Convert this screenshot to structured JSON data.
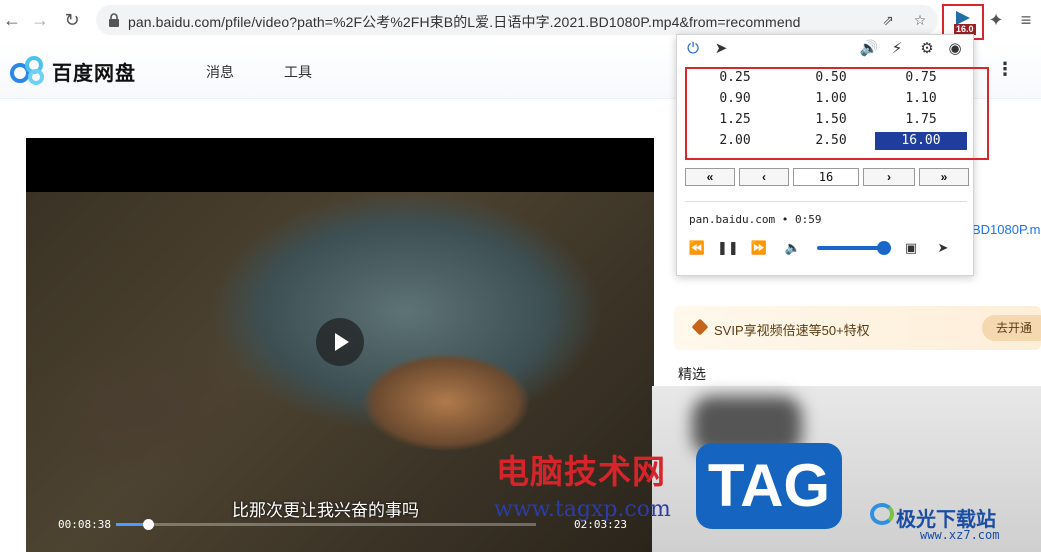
{
  "browser": {
    "url": "pan.baidu.com/pfile/video?path=%2F公考%2FH束B的L爱.日语中字.2021.BD1080P.mp4&from=recommend",
    "extension_badge": "16.0"
  },
  "site": {
    "brand": "百度网盘",
    "menu": [
      "消息",
      "工具"
    ]
  },
  "video": {
    "subtitle": "比那次更让我兴奋的事吗",
    "current_time": "00:08:38",
    "total_time": "02:03:23",
    "progress": 0.077
  },
  "sidebar": {
    "file_name_fragment": "BD1080P.m",
    "svip_text": "SVIP享视频倍速等50+特权",
    "svip_button": "去开通",
    "section_title": "精选"
  },
  "popup": {
    "speeds": [
      "0.25",
      "0.50",
      "0.75",
      "0.90",
      "1.00",
      "1.10",
      "1.25",
      "1.50",
      "1.75",
      "2.00",
      "2.50",
      "16.00"
    ],
    "selected_speed": "16.00",
    "step_buttons": [
      "«",
      "‹",
      "›",
      "»"
    ],
    "step_value": "16",
    "media_info": "pan.baidu.com • 0:59",
    "volume": 0.9
  },
  "watermarks": {
    "cn_site": "电脑技术网",
    "cn_url": "www.tagxp.com",
    "tag": "TAG",
    "jg_name": "极光下载站",
    "jg_url": "www.xz7.com"
  },
  "colors": {
    "accent_blue": "#1a67c9",
    "highlight_red": "#d9262c",
    "selected_speed_bg": "#1f3d9c"
  }
}
